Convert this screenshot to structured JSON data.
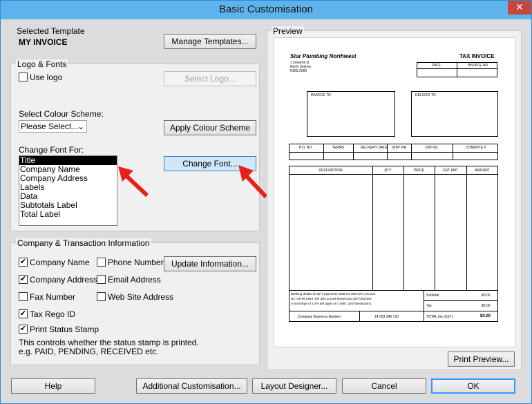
{
  "window": {
    "title": "Basic Customisation",
    "close_glyph": "✕"
  },
  "template": {
    "section_label": "Selected Template",
    "name": "MY INVOICE",
    "manage_button": "Manage Templates..."
  },
  "logo_fonts": {
    "section_label": "Logo & Fonts",
    "use_logo_label": "Use logo",
    "use_logo_checked": false,
    "select_logo_button": "Select Logo...",
    "colour_scheme_label": "Select Colour Scheme:",
    "colour_scheme_value": "Please Select...",
    "apply_colour_button": "Apply Colour Scheme",
    "change_font_for_label": "Change Font For:",
    "font_items": [
      "Title",
      "Company Name",
      "Company Address",
      "Labels",
      "Data",
      "Subtotals Label",
      "Total Label"
    ],
    "selected_font_item": "Title",
    "change_font_button": "Change Font..."
  },
  "company": {
    "section_label": "Company & Transaction Information",
    "checks": [
      {
        "label": "Company Name",
        "checked": true
      },
      {
        "label": "Phone Number",
        "checked": false
      },
      {
        "label": "Company Address",
        "checked": true
      },
      {
        "label": "Email Address",
        "checked": false
      },
      {
        "label": "Fax Number",
        "checked": false
      },
      {
        "label": "Web Site Address",
        "checked": false
      },
      {
        "label": "Tax Rego ID",
        "checked": true
      },
      {
        "label": "Print Status Stamp",
        "checked": true
      }
    ],
    "update_button": "Update Information...",
    "note_line1": "This controls whether the status stamp is printed.",
    "note_line2": "e.g. PAID, PENDING, RECEIVED etc."
  },
  "preview": {
    "section_label": "Preview",
    "print_preview_button": "Print Preview...",
    "invoice": {
      "company": "Star Plumbing Northwest",
      "addr1": "1 noname st",
      "addr2": "North Sydney",
      "addr3": "NSW 2060",
      "title": "TAX INVOICE",
      "date_label": "DATE",
      "invoice_no_label": "INVOICE NO",
      "invoice_to": "INVOICE TO",
      "deliver_to": "DELIVER TO:",
      "info_cols": [
        "P.O. NO.",
        "TERMS",
        "DELIVERY DATE",
        "SHIP VIA",
        "JOB NO.",
        "CONNOTE #"
      ],
      "line_cols": [
        "DESCRIPTION",
        "QTY",
        "PRICE",
        "GST AMT",
        "AMOUNT"
      ],
      "bank_1": "Banking details for EFT payments: BSB No 083-376, Account",
      "bank_2": "No: 03796 5353.  We also accept Mastercard and Visacard.",
      "bank_3": "A surcharge of 1.5% will apply on Credit Card transactions.",
      "subtotal_label": "Subtotal",
      "subtotal_value": "$0.00",
      "tax_label": "Tax",
      "tax_value": "$0.00",
      "biz_no_label": "Company Business Number",
      "biz_no_value": "14 003 348 730",
      "total_label": "TOTAL (inc GST)",
      "total_value": "$0.00"
    }
  },
  "footer": {
    "help": "Help",
    "additional": "Additional Customisation...",
    "layout": "Layout Designer...",
    "cancel": "Cancel",
    "ok": "OK"
  },
  "colors": {
    "titlebar": "#5fb3ec",
    "arrow": "#e8201a",
    "close": "#c7473a"
  }
}
